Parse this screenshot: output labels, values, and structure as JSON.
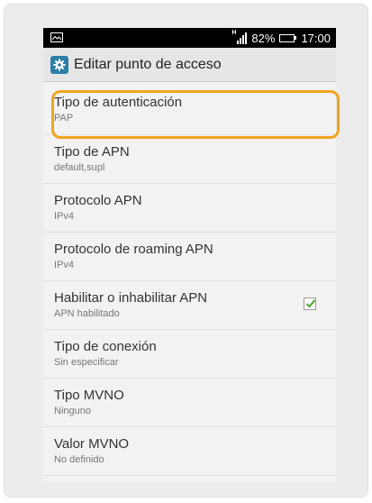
{
  "status_bar": {
    "battery_percent": "82%",
    "time": "17:00",
    "signal_type": "H"
  },
  "action_bar": {
    "title": "Editar punto de acceso"
  },
  "settings": [
    {
      "title": "Tipo de autenticación",
      "summary": "PAP"
    },
    {
      "title": "Tipo de APN",
      "summary": "default,supl"
    },
    {
      "title": "Protocolo APN",
      "summary": "IPv4"
    },
    {
      "title": "Protocolo de roaming APN",
      "summary": "IPv4"
    },
    {
      "title": "Habilitar o inhabilitar APN",
      "summary": "APN habilitado",
      "checked": true
    },
    {
      "title": "Tipo de conexión",
      "summary": "Sin especificar"
    },
    {
      "title": "Tipo MVNO",
      "summary": "Ninguno"
    },
    {
      "title": "Valor MVNO",
      "summary": "No definido"
    }
  ],
  "colors": {
    "highlight": "#f0a51e",
    "check": "#5aa832",
    "app_icon": "#2c7fa7"
  },
  "icons": [
    "image-icon",
    "signal-icon",
    "battery-icon",
    "gear-icon",
    "checkmark-icon"
  ]
}
